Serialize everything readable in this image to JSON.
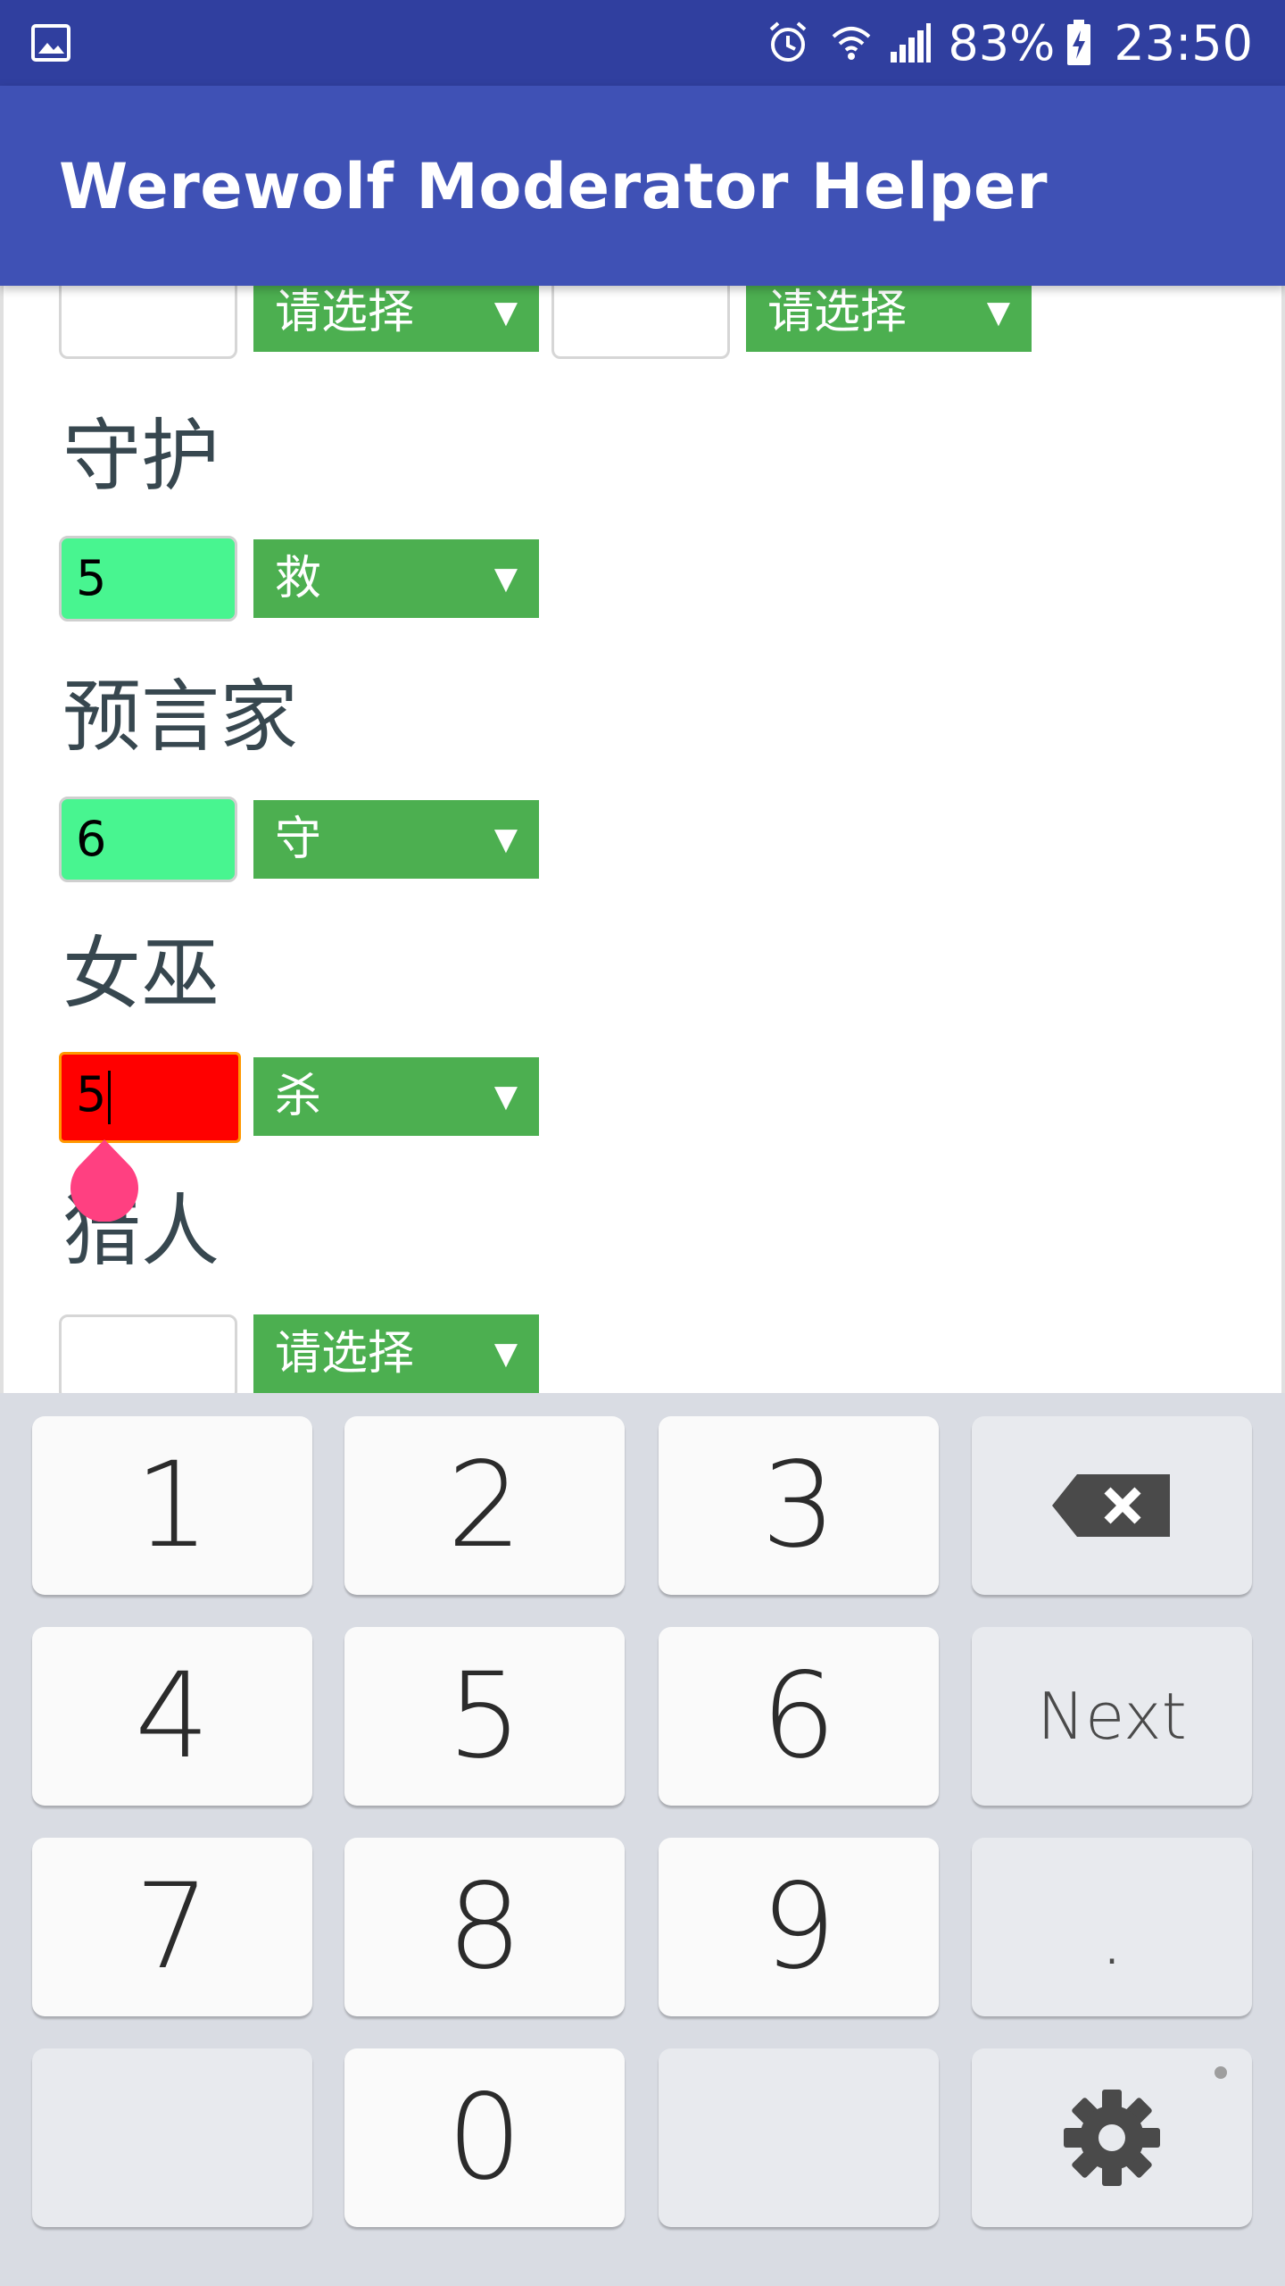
{
  "status_bar": {
    "battery_percent": "83%",
    "time": "23:50",
    "icons": [
      "image-icon",
      "alarm-icon",
      "wifi-icon",
      "signal-icon",
      "battery-charging-icon"
    ]
  },
  "app_bar": {
    "title": "Werewolf Moderator Helper",
    "color": "#3f51b5",
    "status_color": "#303f9f"
  },
  "content": {
    "top_row": {
      "input1_value": "",
      "spinner1_label": "请选择",
      "input2_value": "",
      "spinner2_label": "请选择"
    },
    "roles": [
      {
        "label": "守护",
        "input_value": "5",
        "action": "救",
        "input_state": "filled"
      },
      {
        "label": "预言家",
        "input_value": "6",
        "action": "守",
        "input_state": "filled"
      },
      {
        "label": "女巫",
        "input_value": "5",
        "action": "杀",
        "input_state": "focused-error"
      },
      {
        "label": "猎人",
        "input_value": "",
        "action": "请选择",
        "input_state": "empty"
      }
    ],
    "spinner_arrow": "▼",
    "colors": {
      "spinner_bg": "#4caf50",
      "filled_input_bg": "#48f590",
      "error_input_bg": "#ff0000",
      "focus_border": "#ff9800",
      "handle": "#ff4081",
      "role_text": "#37474f"
    }
  },
  "keyboard": {
    "rows": [
      [
        "1",
        "2",
        "3",
        "backspace"
      ],
      [
        "4",
        "5",
        "6",
        "Next"
      ],
      [
        "7",
        "8",
        "9",
        "."
      ],
      [
        "",
        "0",
        "",
        "settings"
      ]
    ],
    "next_label": "Next",
    "period_label": ".",
    "icons": {
      "backspace": "backspace-icon",
      "settings": "gear-icon"
    }
  }
}
